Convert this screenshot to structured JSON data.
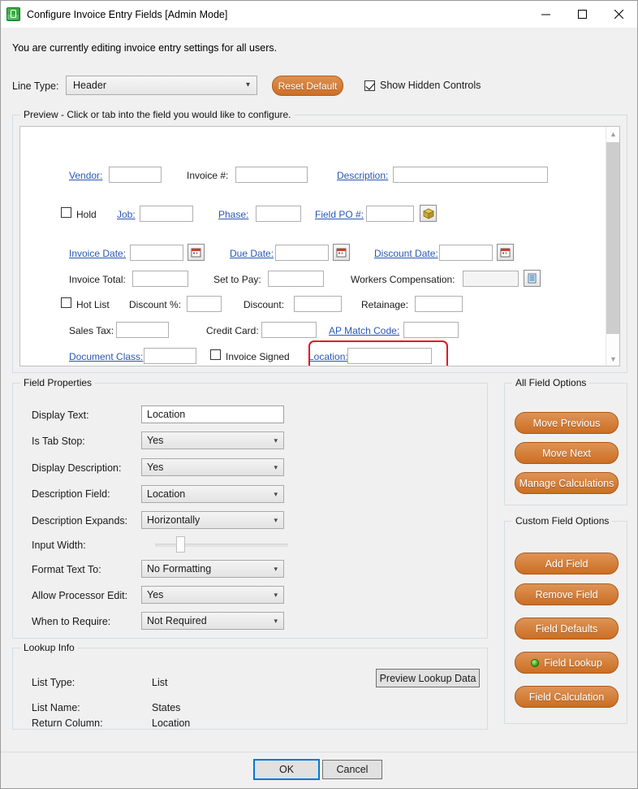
{
  "window": {
    "title": "Configure Invoice Entry Fields [Admin Mode]",
    "app_icon": "lock-green-icon",
    "minimize": "—",
    "maximize": "□",
    "close": "✕"
  },
  "header": {
    "intro": "You are currently editing invoice entry settings for all users.",
    "line_type_label": "Line Type:",
    "line_type_value": "Header",
    "reset_default_label": "Reset Default",
    "show_hidden_label": "Show Hidden Controls",
    "show_hidden_checked": true,
    "accent_orange": "#cd6f24"
  },
  "preview": {
    "title": "Preview - Click or tab into the field you would like to configure.",
    "selection_color": "#e81123",
    "fields": [
      {
        "label": "Vendor:",
        "link": true
      },
      {
        "label": "Invoice #:",
        "link": false
      },
      {
        "label": "Description:",
        "link": true
      },
      {
        "label": "Hold",
        "type": "checkbox"
      },
      {
        "label": "Job:",
        "link": true
      },
      {
        "label": "Phase:",
        "link": true
      },
      {
        "label": "Field PO #:",
        "link": true,
        "icon": "cube-icon"
      },
      {
        "label": "Invoice Date:",
        "link": true,
        "icon": "calendar-icon"
      },
      {
        "label": "Due Date:",
        "link": true,
        "icon": "calendar-icon"
      },
      {
        "label": "Discount Date:",
        "link": true,
        "icon": "calendar-icon"
      },
      {
        "label": "Invoice Total:",
        "link": false
      },
      {
        "label": "Set to Pay:",
        "link": false
      },
      {
        "label": "Workers Compensation:",
        "link": false,
        "disabled": true,
        "icon": "list-icon"
      },
      {
        "label": "Hot List",
        "type": "checkbox"
      },
      {
        "label": "Discount %:",
        "link": false
      },
      {
        "label": "Discount:",
        "link": false
      },
      {
        "label": "Retainage:",
        "link": false
      },
      {
        "label": "Sales Tax:",
        "link": false
      },
      {
        "label": "Credit Card:",
        "link": false
      },
      {
        "label": "AP Match Code:",
        "link": true
      },
      {
        "label": "Document Class:",
        "link": true
      },
      {
        "label": "Invoice Signed",
        "type": "checkbox"
      },
      {
        "label": "Location:",
        "link": true,
        "selected": true
      }
    ]
  },
  "field_properties": {
    "title": "Field Properties",
    "rows": [
      {
        "label": "Display Text:",
        "value": "Location",
        "control": "text"
      },
      {
        "label": "Is Tab Stop:",
        "value": "Yes",
        "control": "select"
      },
      {
        "label": "Display Description:",
        "value": "Yes",
        "control": "select"
      },
      {
        "label": "Description Field:",
        "value": "Location",
        "control": "select"
      },
      {
        "label": "Description Expands:",
        "value": "Horizontally",
        "control": "select"
      },
      {
        "label": "Input Width:",
        "value": "",
        "control": "slider",
        "slider_percent": 22
      },
      {
        "label": "Format Text To:",
        "value": "No Formatting",
        "control": "select"
      },
      {
        "label": "Allow Processor Edit:",
        "value": "Yes",
        "control": "select"
      },
      {
        "label": "When to Require:",
        "value": "Not Required",
        "control": "select"
      }
    ]
  },
  "lookup_info": {
    "title": "Lookup Info",
    "rows": [
      {
        "label": "List Type:",
        "value": "List"
      },
      {
        "label": "List Name:",
        "value": "States"
      },
      {
        "label": "Return Column:",
        "value": "Location"
      }
    ],
    "preview_button": "Preview Lookup Data"
  },
  "all_field_options": {
    "title": "All Field Options",
    "buttons": [
      {
        "label": "Move Previous"
      },
      {
        "label": "Move Next"
      },
      {
        "label": "Manage Calculations"
      }
    ]
  },
  "custom_field_options": {
    "title": "Custom Field Options",
    "buttons": [
      {
        "label": "Add Field"
      },
      {
        "label": "Remove Field"
      },
      {
        "label": "Field Defaults"
      },
      {
        "label": "Field Lookup",
        "icon": "green-dot-icon"
      },
      {
        "label": "Field Calculation"
      }
    ]
  },
  "footer": {
    "ok_label": "OK",
    "cancel_label": "Cancel"
  }
}
